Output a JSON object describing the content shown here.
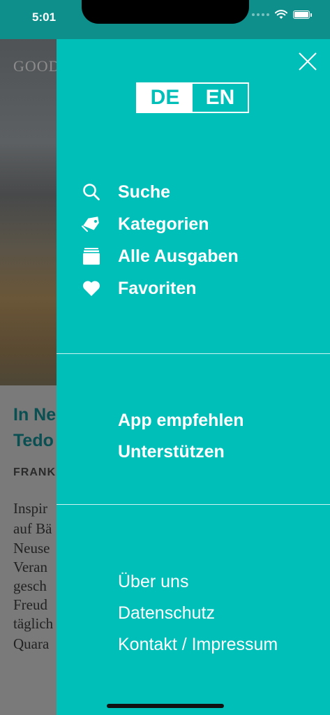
{
  "status_bar": {
    "time": "5:01"
  },
  "background_article": {
    "masthead": "GOOD",
    "title_line1": "In Ne",
    "title_line2": "Tedo",
    "author": "FRANK",
    "body_lines": [
      "Inspir",
      "auf Bä",
      "Neuse",
      "Veran",
      "gesch",
      "Freud",
      "täglich",
      "Quara"
    ]
  },
  "drawer": {
    "close_icon": "close-icon",
    "language": {
      "de": "DE",
      "en": "EN",
      "selected": "DE"
    },
    "menu": [
      {
        "label": "Suche",
        "icon": "search-icon"
      },
      {
        "label": "Kategorien",
        "icon": "tag-icon"
      },
      {
        "label": "Alle Ausgaben",
        "icon": "archive-icon"
      },
      {
        "label": "Favoriten",
        "icon": "heart-icon"
      }
    ],
    "secondary": [
      {
        "label": "App empfehlen"
      },
      {
        "label": "Unterstützen"
      }
    ],
    "footer_links": [
      {
        "label": "Über uns"
      },
      {
        "label": "Datenschutz"
      },
      {
        "label": "Kontakt / Impressum"
      }
    ]
  },
  "colors": {
    "accent": "#00bfb9",
    "status_bar": "#0e8f8b",
    "text_on_accent": "#ffffff"
  }
}
